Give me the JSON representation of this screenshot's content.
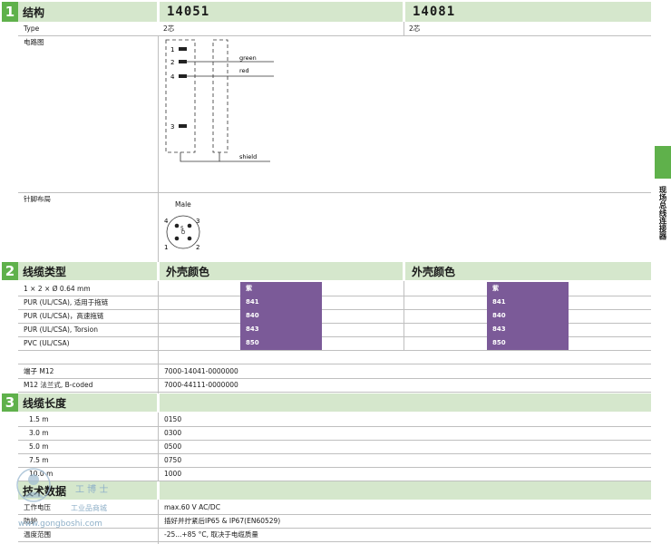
{
  "side_tab": {
    "label": "现场总线连接器"
  },
  "section1": {
    "num": "1",
    "title": "结构",
    "products": [
      "14051",
      "14081"
    ],
    "type_label": "Type",
    "type_values": [
      "2芯",
      "2芯"
    ],
    "circuit_label": "电路图",
    "circuit": {
      "pins": [
        "1",
        "2",
        "4",
        "3"
      ],
      "wires": [
        "green",
        "red",
        "shield"
      ]
    },
    "pinout_label": "针脚布局",
    "pinout": {
      "gender": "Male",
      "pins": [
        "4",
        "3",
        "5",
        "1",
        "2"
      ]
    }
  },
  "section2": {
    "num": "2",
    "title": "线缆类型",
    "col_title": "外壳颜色",
    "col_title2": "外壳颜色",
    "rows": [
      {
        "label": "1 × 2 × Ø 0.64 mm",
        "codes": [
          "紫",
          "紫"
        ]
      },
      {
        "label": "PUR (UL/CSA), 适用于拖链",
        "codes": [
          "841",
          "841"
        ]
      },
      {
        "label": "PUR (UL/CSA)，高速拖链",
        "codes": [
          "840",
          "840"
        ]
      },
      {
        "label": "PUR (UL/CSA), Torsion",
        "codes": [
          "843",
          "843"
        ]
      },
      {
        "label": "PVC (UL/CSA)",
        "codes": [
          "850",
          "850"
        ]
      }
    ],
    "extra": [
      {
        "label": "端子 M12",
        "value": "7000-14041-0000000"
      },
      {
        "label": "M12 法兰式, B-coded",
        "value": "7000-44111-0000000"
      }
    ]
  },
  "section3": {
    "num": "3",
    "title": "线缆长度",
    "rows": [
      {
        "label": "1.5 m",
        "value": "0150"
      },
      {
        "label": "3.0 m",
        "value": "0300"
      },
      {
        "label": "5.0 m",
        "value": "0500"
      },
      {
        "label": "7.5 m",
        "value": "0750"
      },
      {
        "label": "10.0 m",
        "value": "1000"
      }
    ]
  },
  "section4": {
    "title": "技术数据",
    "rows": [
      {
        "label": "工作电压",
        "value": "max.60 V AC/DC"
      },
      {
        "label": "防护",
        "value": "插好并拧紧后IP65 & IP67(EN60529)"
      },
      {
        "label": "温度范围",
        "value": "-25...+85 °C, 取决于电缆质量"
      }
    ]
  },
  "watermark": {
    "brand": "工 博 士",
    "sub": "工业品商城",
    "url": "www.gongboshi.com"
  },
  "colors": {
    "green": "#5fb14b",
    "light_green": "#d5e7cc",
    "purple": "#7b5a98"
  }
}
